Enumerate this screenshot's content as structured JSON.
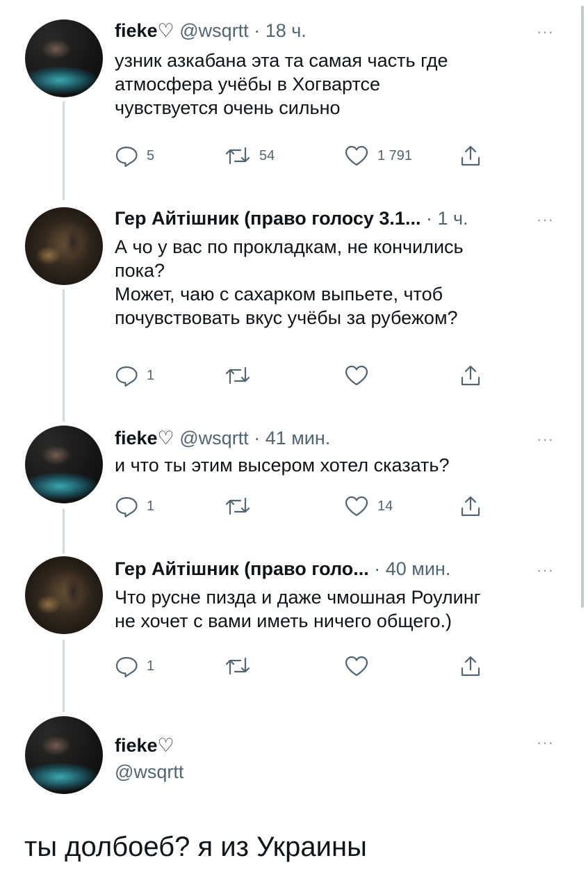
{
  "tweets": [
    {
      "name": "fieke♡",
      "handle": "@wsqrtt",
      "time": "· 18 ч.",
      "text": [
        "узник азкабана эта та самая часть где",
        "атмосфера учёбы в Хогвартсе",
        "чувствуется очень сильно"
      ],
      "replies": "5",
      "retweets": "54",
      "likes": "1 791"
    },
    {
      "name": "Гер Айтішник (право голосу 3.1...",
      "handle": "",
      "time": "· 1 ч.",
      "text": [
        "А чо у вас по прокладкам, не кончились",
        "пока?",
        "Может, чаю с сахарком выпьете, чтоб",
        "почувствовать вкус учёбы за рубежом?"
      ],
      "replies": "1",
      "retweets": "",
      "likes": ""
    },
    {
      "name": "fieke♡",
      "handle": "@wsqrtt",
      "time": "· 41 мин.",
      "text": [
        "и что ты этим высером хотел сказать?"
      ],
      "replies": "1",
      "retweets": "",
      "likes": "14"
    },
    {
      "name": "Гер Айтішник (право голо...",
      "handle": "",
      "time": "· 40 мин.",
      "text": [
        "Что русне пизда и даже чмошная Роулинг",
        "не хочет с вами иметь ничего общего.)"
      ],
      "replies": "1",
      "retweets": "",
      "likes": ""
    }
  ],
  "reply_composer": {
    "name": "fieke♡",
    "handle": "@wsqrtt",
    "text": "ты долбоеб? я из Украины"
  },
  "more_label": "···",
  "icons": {
    "reply": "reply-icon",
    "retweet": "retweet-icon",
    "like": "heart-icon",
    "share": "share-icon",
    "more": "more-icon"
  },
  "colors": {
    "text": "#0f1419",
    "muted": "#536471",
    "thread_line": "#cfd9de"
  }
}
